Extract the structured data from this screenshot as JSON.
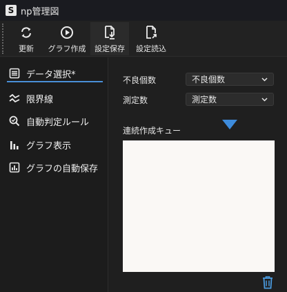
{
  "window": {
    "logo_letter": "S",
    "title": "np管理図"
  },
  "toolbar": {
    "buttons": [
      {
        "label": "更新",
        "icon": "refresh-icon"
      },
      {
        "label": "グラフ作成",
        "icon": "play-circle-icon"
      },
      {
        "label": "設定保存",
        "icon": "file-download-icon",
        "active": true
      },
      {
        "label": "設定読込",
        "icon": "file-open-icon"
      }
    ]
  },
  "sidebar": {
    "items": [
      {
        "label": "データ選択*",
        "icon": "list-icon",
        "selected": true
      },
      {
        "label": "限界線",
        "icon": "limit-lines-icon"
      },
      {
        "label": "自動判定ルール",
        "icon": "search-check-icon"
      },
      {
        "label": "グラフ表示",
        "icon": "bar-chart-icon"
      },
      {
        "label": "グラフの自動保存",
        "icon": "chart-save-icon"
      }
    ]
  },
  "main": {
    "fields": [
      {
        "label": "不良個数",
        "value": "不良個数"
      },
      {
        "label": "測定数",
        "value": "測定数"
      }
    ],
    "queue_label": "連続作成キュー"
  },
  "colors": {
    "accent": "#4a90d9",
    "drop_arrow": "#3d8bdc",
    "trash": "#4a9be0",
    "queue_bg": "#faf8f5"
  }
}
